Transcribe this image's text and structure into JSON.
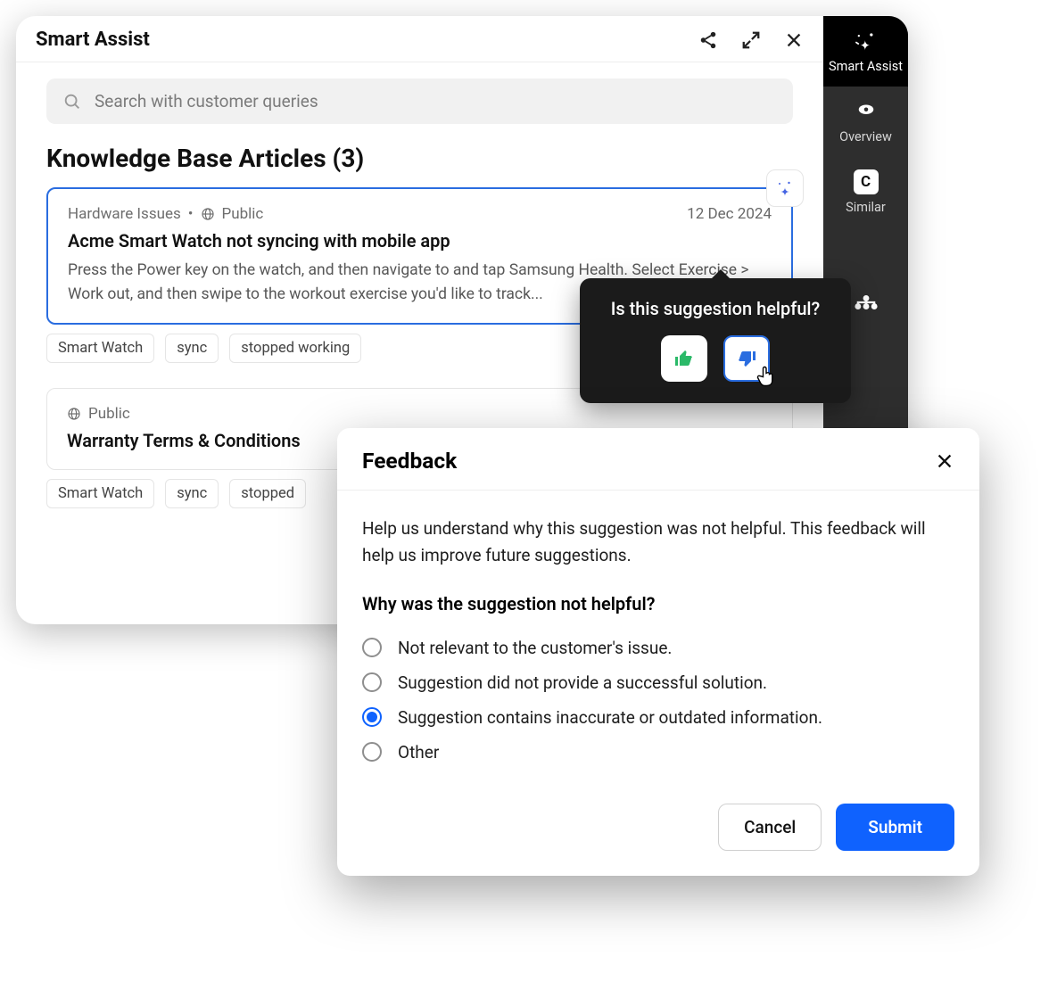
{
  "app": {
    "title": "Smart Assist"
  },
  "search": {
    "placeholder": "Search with customer queries"
  },
  "section": {
    "title": "Knowledge Base Articles (3)"
  },
  "articles": [
    {
      "category": "Hardware Issues",
      "visibility": "Public",
      "date": "12 Dec 2024",
      "title": "Acme Smart Watch not syncing with mobile app",
      "excerpt": "Press the Power key on the watch, and then navigate to and tap Samsung Health. Select Exercise > Work out, and then swipe to the workout exercise you'd like to track...",
      "tags": [
        "Smart Watch",
        "sync",
        "stopped working"
      ]
    },
    {
      "visibility": "Public",
      "title": "Warranty Terms & Conditions",
      "tags": [
        "Smart Watch",
        "sync",
        "stopped"
      ]
    }
  ],
  "rail": {
    "items": [
      {
        "label": "Smart Assist"
      },
      {
        "label": "Overview"
      },
      {
        "label": "Similar"
      }
    ]
  },
  "popover": {
    "title": "Is this suggestion helpful?"
  },
  "feedback": {
    "title": "Feedback",
    "description": "Help us understand why this suggestion was not helpful. This feedback will help us improve future suggestions.",
    "question": "Why was the suggestion not helpful?",
    "options": [
      {
        "label": "Not relevant to the customer's issue.",
        "selected": false
      },
      {
        "label": "Suggestion did not provide a successful solution.",
        "selected": false
      },
      {
        "label": "Suggestion contains inaccurate or outdated information.",
        "selected": true
      },
      {
        "label": "Other",
        "selected": false
      }
    ],
    "cancel": "Cancel",
    "submit": "Submit"
  }
}
